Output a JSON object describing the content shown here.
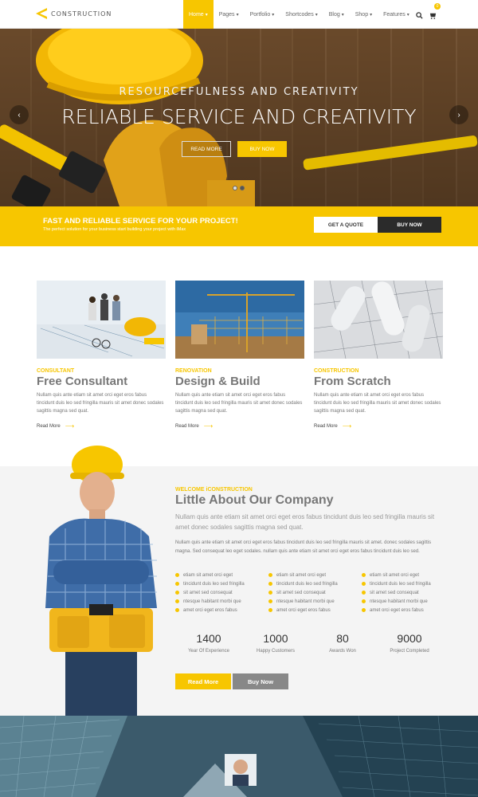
{
  "brand": {
    "name": "CONSTRUCTION"
  },
  "nav": {
    "items": [
      {
        "label": "Home",
        "caret": "▾",
        "active": true
      },
      {
        "label": "Pages",
        "caret": "▾"
      },
      {
        "label": "Portfolio",
        "caret": "▾"
      },
      {
        "label": "Shortcodes",
        "caret": "▾"
      },
      {
        "label": "Blog",
        "caret": "▾"
      },
      {
        "label": "Shop",
        "caret": "▾"
      },
      {
        "label": "Features",
        "caret": "▾"
      }
    ],
    "cart_count": "0"
  },
  "hero": {
    "subtitle": "RESOURCEFULNESS AND CREATIVITY",
    "title": "RELIABLE SERVICE AND CREATIVITY",
    "btn_read_more": "READ MORE",
    "btn_buy_now": "BUY NOW",
    "prev": "‹",
    "next": "›"
  },
  "band": {
    "title": "FAST AND RELIABLE SERVICE FOR YOUR PROJECT!",
    "subtitle": "The perfect solution for your business start building your project with iMax",
    "btn_quote": "GET A QUOTE",
    "btn_buy": "BUY NOW"
  },
  "services": [
    {
      "tag": "CONSULTANT",
      "title": "Free Consultant",
      "text": "Nullam quis ante etiam sit amet orci eget eros fabus tincidunt duis leo sed fringilla mauris sit amet donec sodales sagittis magna sed quat.",
      "more": "Read More",
      "arrow": "⟶"
    },
    {
      "tag": "RENOVATION",
      "title": "Design & Build",
      "text": "Nullam quis ante etiam sit amet orci eget eros fabus tincidunt duis leo sed fringilla mauris sit amet donec sodales sagittis magna sed quat.",
      "more": "Read More",
      "arrow": "⟶"
    },
    {
      "tag": "CONSTRUCTION",
      "title": "From Scratch",
      "text": "Nullam quis ante etiam sit amet orci eget eros fabus tincidunt duis leo sed fringilla mauris sit amet donec sodales sagittis magna sed quat.",
      "more": "Read More",
      "arrow": "⟶"
    }
  ],
  "about": {
    "tag": "WELCOME iCONSTRUCTION",
    "title": "Little About Our Company",
    "lead": "Nullam quis ante etiam sit amet orci eget eros fabus tincidunt duis leo sed fringilla mauris sit amet donec sodales sagittis magna sed quat.",
    "body": "Nullam quis ante etiam sit amet orci eget eros fabus tincidunt duis leo sed fringilla mauris sit amet. donec sodales sagittis magna. Sed consequat leo eget sodales. nullam quis ante etiam sit amet orci eget eros fabus tincidunt duis leo sed.",
    "checklist": [
      [
        "etiam sit amet orci eget",
        "tincidunt duis leo sed fringilla",
        "sit amet sed consequat",
        "ntesque habitant morbi que",
        "amet orci eget eros fabus"
      ],
      [
        "etiam sit amet orci eget",
        "tincidunt duis leo sed fringilla",
        "sit amet sed consequat",
        "ntesque habitant morbi que",
        "amet orci eget eros fabus"
      ],
      [
        "etiam sit amet orci eget",
        "tincidunt duis leo sed fringilla",
        "sit amet sed consequat",
        "ntesque habitant morbi que",
        "amet orci eget eros fabus"
      ]
    ],
    "stats": [
      {
        "value": "1400",
        "label": "Year Of Experience"
      },
      {
        "value": "1000",
        "label": "Happy Customers"
      },
      {
        "value": "80",
        "label": "Awards Won"
      },
      {
        "value": "9000",
        "label": "Project Completed"
      }
    ],
    "btn_read_more": "Read More",
    "btn_buy_now": "Buy Now"
  },
  "colors": {
    "accent": "#f7c600",
    "dark": "#2b2b2b",
    "grey_button": "#888888"
  },
  "icons": {
    "search": "search-icon",
    "cart": "cart-icon",
    "check": "check-circle-icon"
  }
}
